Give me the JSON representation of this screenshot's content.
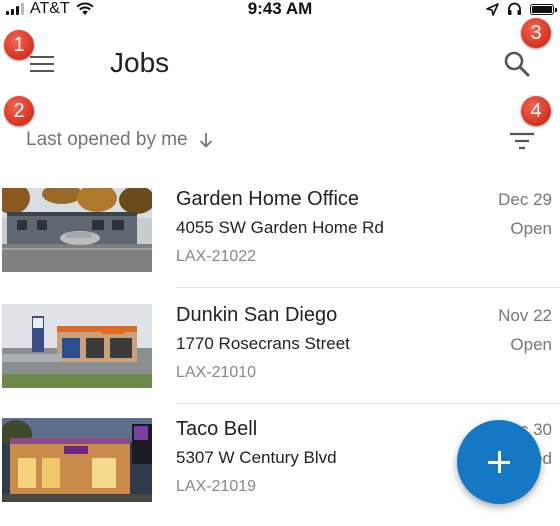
{
  "status_bar": {
    "carrier": "AT&T",
    "time": "9:43 AM",
    "icons": [
      "signal-icon",
      "wifi-icon",
      "location-icon",
      "headphones-icon",
      "battery-icon"
    ]
  },
  "header": {
    "title": "Jobs",
    "menu_icon": "hamburger-menu-icon",
    "search_icon": "search-icon"
  },
  "sort": {
    "label": "Last opened by me",
    "direction_icon": "arrow-down-icon",
    "filter_icon": "filter-icon"
  },
  "callouts": [
    "1",
    "2",
    "3",
    "4"
  ],
  "jobs": [
    {
      "title": "Garden Home Office",
      "address": "4055 SW Garden Home Rd",
      "code": "LAX-21022",
      "date": "Dec 29",
      "status": "Open"
    },
    {
      "title": "Dunkin San Diego",
      "address": "1770 Rosecrans Street",
      "code": "LAX-21010",
      "date": "Nov 22",
      "status": "Open"
    },
    {
      "title": "Taco Bell",
      "address": "5307 W Century Blvd",
      "code": "LAX-21019",
      "date": "Dec 30",
      "status": "Closed"
    }
  ],
  "fab": {
    "icon": "plus-icon"
  },
  "colors": {
    "accent": "#1478c4",
    "callout": "#d7301f",
    "muted_text": "#777777"
  }
}
